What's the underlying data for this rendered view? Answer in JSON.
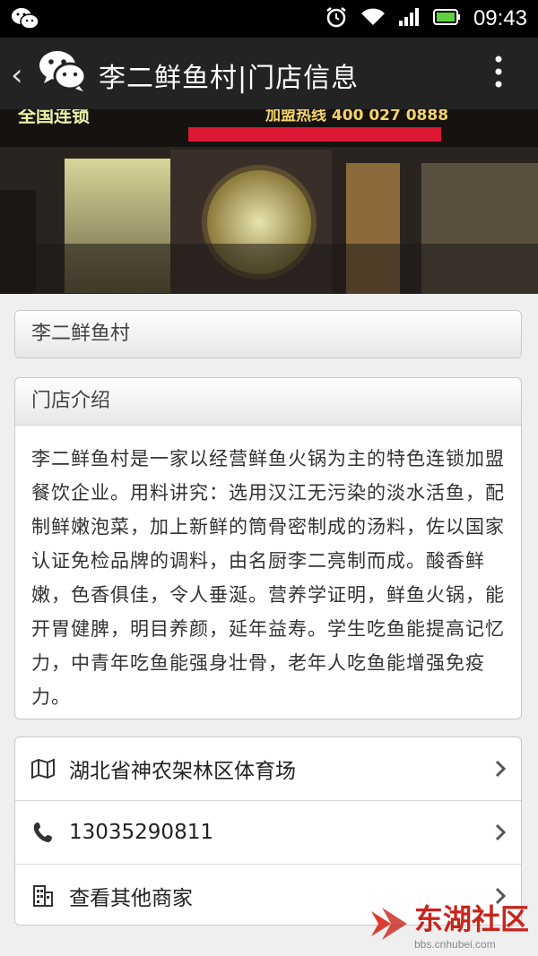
{
  "status_bar": {
    "time": "09:43"
  },
  "header": {
    "title": "李二鲜鱼村|门店信息"
  },
  "banner": {
    "sign_left": "全国连锁",
    "sign_right": "加盟热线 400 027 0888"
  },
  "store": {
    "name": "李二鲜鱼村"
  },
  "intro": {
    "heading": "门店介绍",
    "text": "李二鲜鱼村是一家以经营鲜鱼火锅为主的特色连锁加盟餐饮企业。用料讲究：选用汉江无污染的淡水活鱼，配制鲜嫩泡菜，加上新鲜的筒骨密制成的汤料，佐以国家认证免检品牌的调料，由名厨李二亮制而成。酸香鲜嫩，色香俱佳，令人垂涎。营养学证明，鲜鱼火锅，能开胃健脾，明目养颜，延年益寿。学生吃鱼能提高记忆力，中青年吃鱼能强身壮骨，老年人吃鱼能增强免疫力。"
  },
  "info_rows": {
    "address": "湖北省神农架林区体育场",
    "phone": "13035290811",
    "others": "查看其他商家"
  },
  "watermark": {
    "brand": "东湖社区",
    "url": "bbs.cnhubei.com"
  },
  "colors": {
    "status_bar": "#000000",
    "action_bar": "#232323",
    "background": "#efefef",
    "neon_red": "#ff1a3c"
  }
}
